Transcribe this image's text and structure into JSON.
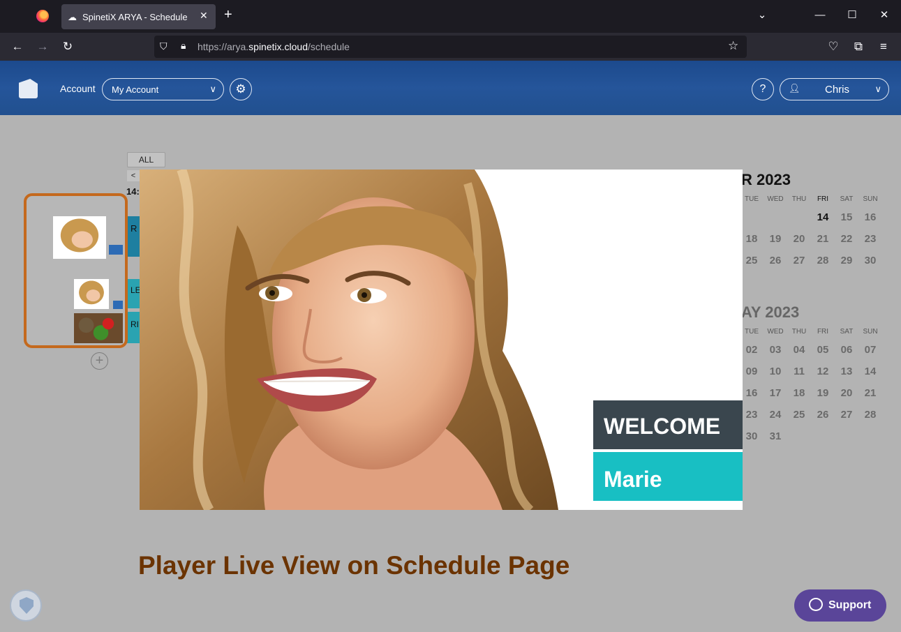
{
  "browser": {
    "tab_title": "SpinetiX ARYA - Schedule",
    "url_prefix": "https://arya.",
    "url_domain": "spinetix.cloud",
    "url_path": "/schedule"
  },
  "header": {
    "account_label": "Account",
    "account_select": "My Account",
    "help_label": "?",
    "user_name": "Chris"
  },
  "schedule": {
    "filter_all": "ALL",
    "time_fragment": "14:",
    "row_fragments": [
      "R",
      "LE",
      "RI"
    ]
  },
  "calendar": {
    "months": [
      {
        "title": "R 2023",
        "weekdays": [
          "TUE",
          "WED",
          "THU",
          "FRI",
          "SAT",
          "SUN"
        ],
        "today_label": "FRI",
        "rows": [
          [
            "",
            "",
            "",
            "14",
            "15",
            "16"
          ],
          [
            "18",
            "19",
            "20",
            "21",
            "22",
            "23"
          ],
          [
            "25",
            "26",
            "27",
            "28",
            "29",
            "30"
          ]
        ]
      },
      {
        "title": "AY 2023",
        "weekdays": [
          "TUE",
          "WED",
          "THU",
          "FRI",
          "SAT",
          "SUN"
        ],
        "rows": [
          [
            "02",
            "03",
            "04",
            "05",
            "06",
            "07"
          ],
          [
            "09",
            "10",
            "11",
            "12",
            "13",
            "14"
          ],
          [
            "16",
            "17",
            "18",
            "19",
            "20",
            "21"
          ],
          [
            "23",
            "24",
            "25",
            "26",
            "27",
            "28"
          ],
          [
            "30",
            "31",
            "",
            "",
            "",
            ""
          ]
        ]
      }
    ]
  },
  "live_view": {
    "welcome_text": "WELCOME",
    "name_text": "Marie"
  },
  "page_caption": "Player Live View on Schedule Page",
  "support_label": "Support",
  "colors": {
    "header_blue": "#21508f",
    "playlist_border": "#c4691d",
    "caption": "#6b3300",
    "welcome_bg": "#3a464e",
    "name_bg": "#18bfc3",
    "support_bg": "#5a4599"
  }
}
